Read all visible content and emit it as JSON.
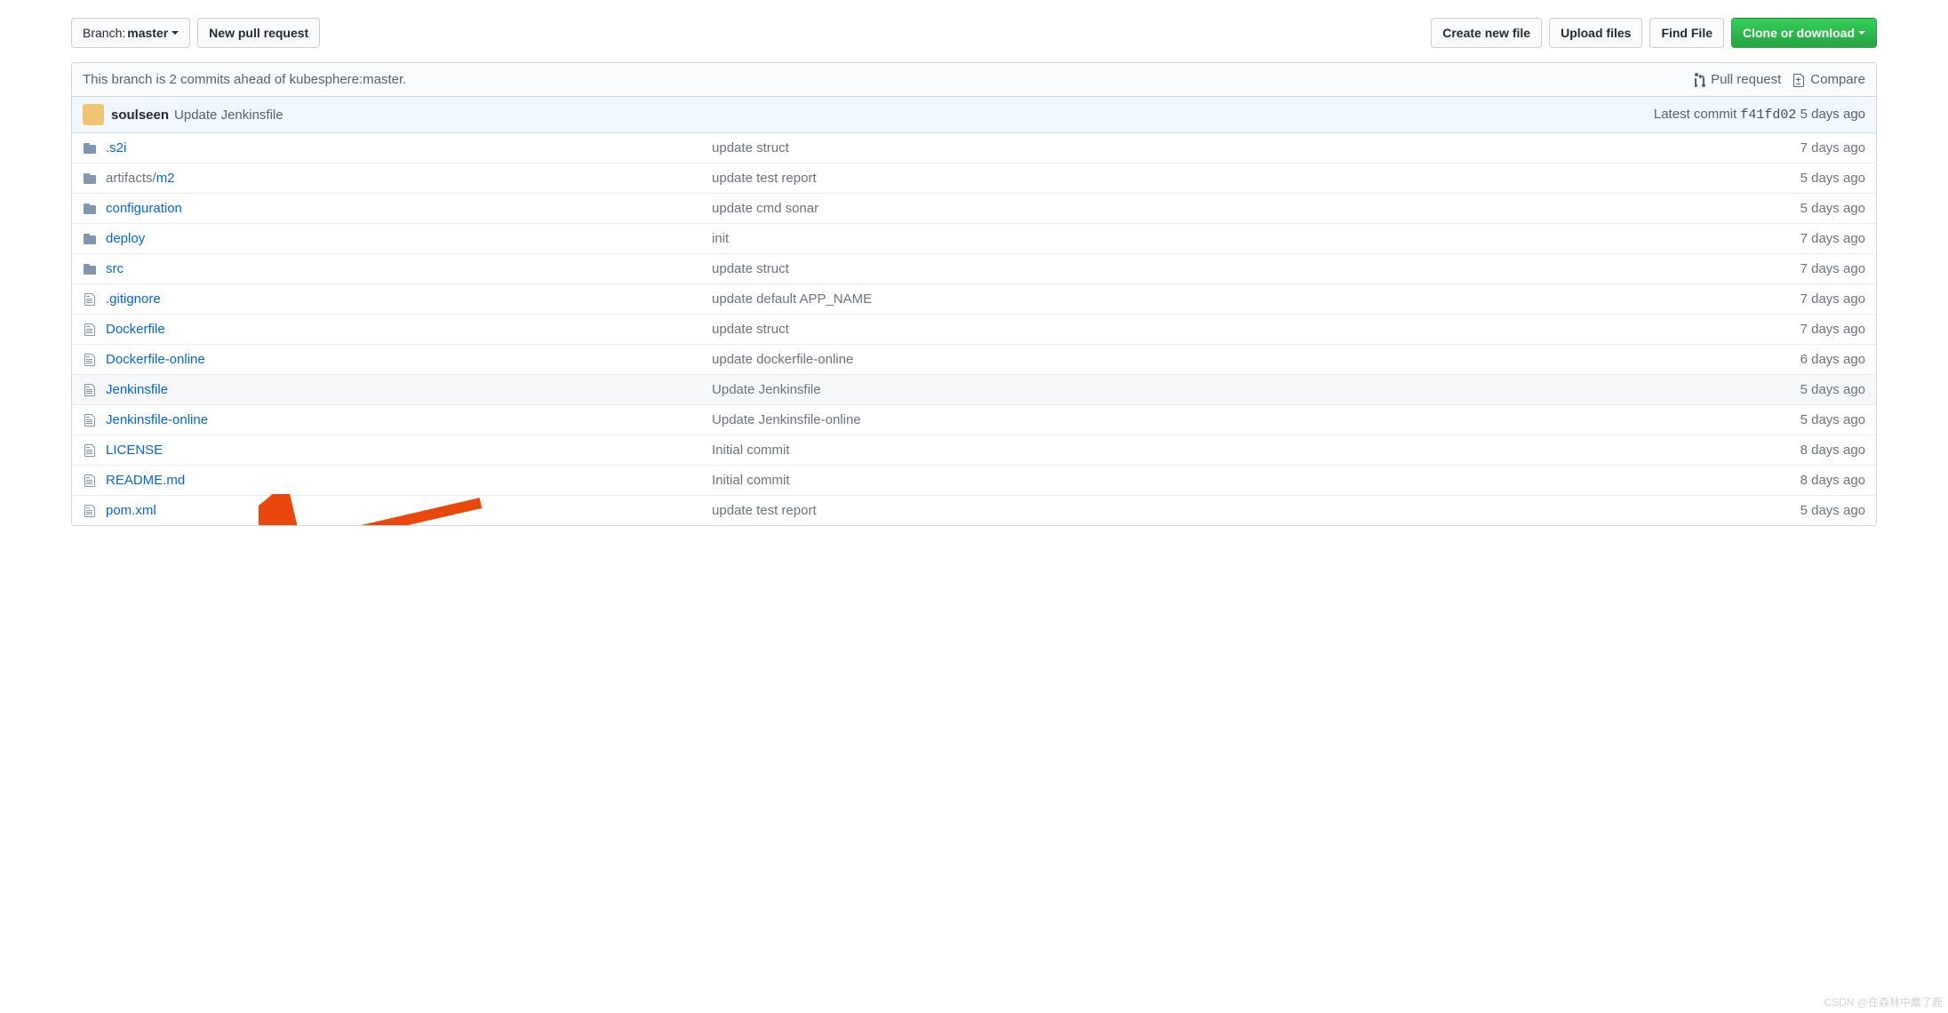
{
  "toolbar": {
    "branch_label": "Branch:",
    "branch_name": "master",
    "new_pr": "New pull request",
    "create_file": "Create new file",
    "upload": "Upload files",
    "find": "Find File",
    "clone": "Clone or download"
  },
  "branch_status": {
    "text": "This branch is 2 commits ahead of kubesphere:master.",
    "pull_request": "Pull request",
    "compare": "Compare"
  },
  "commit_bar": {
    "author": "soulseen",
    "message": "Update Jenkinsfile",
    "latest_label": "Latest commit",
    "sha": "f41fd02",
    "age": "5 days ago"
  },
  "files": [
    {
      "type": "dir",
      "name": ".s2i",
      "name_prefix": "",
      "name_suffix": "",
      "msg": "update struct",
      "age": "7 days ago",
      "highlight": false
    },
    {
      "type": "dir",
      "name": "m2",
      "name_prefix": "artifacts/",
      "name_suffix": "",
      "msg": "update test report",
      "age": "5 days ago",
      "highlight": false
    },
    {
      "type": "dir",
      "name": "configuration",
      "name_prefix": "",
      "name_suffix": "",
      "msg": "update cmd sonar",
      "age": "5 days ago",
      "highlight": false
    },
    {
      "type": "dir",
      "name": "deploy",
      "name_prefix": "",
      "name_suffix": "",
      "msg": "init",
      "age": "7 days ago",
      "highlight": false
    },
    {
      "type": "dir",
      "name": "src",
      "name_prefix": "",
      "name_suffix": "",
      "msg": "update struct",
      "age": "7 days ago",
      "highlight": false
    },
    {
      "type": "file",
      "name": ".gitignore",
      "name_prefix": "",
      "name_suffix": "",
      "msg": "update default APP_NAME",
      "age": "7 days ago",
      "highlight": false
    },
    {
      "type": "file",
      "name": "Dockerfile",
      "name_prefix": "",
      "name_suffix": "",
      "msg": "update struct",
      "age": "7 days ago",
      "highlight": false
    },
    {
      "type": "file",
      "name": "Dockerfile-online",
      "name_prefix": "",
      "name_suffix": "",
      "msg": "update dockerfile-online",
      "age": "6 days ago",
      "highlight": false
    },
    {
      "type": "file",
      "name": "Jenkinsfile",
      "name_prefix": "",
      "name_suffix": "",
      "msg": "Update Jenkinsfile",
      "age": "5 days ago",
      "highlight": true
    },
    {
      "type": "file",
      "name": "Jenkinsfile-online",
      "name_prefix": "",
      "name_suffix": "",
      "msg": "Update Jenkinsfile-online",
      "age": "5 days ago",
      "highlight": false
    },
    {
      "type": "file",
      "name": "LICENSE",
      "name_prefix": "",
      "name_suffix": "",
      "msg": "Initial commit",
      "age": "8 days ago",
      "highlight": false
    },
    {
      "type": "file",
      "name": "README.md",
      "name_prefix": "",
      "name_suffix": "",
      "msg": "Initial commit",
      "age": "8 days ago",
      "highlight": false
    },
    {
      "type": "file",
      "name": "pom.xml",
      "name_prefix": "",
      "name_suffix": "",
      "msg": "update test report",
      "age": "5 days ago",
      "highlight": false
    }
  ],
  "watermark": "CSDN @在森林中麋了鹿"
}
